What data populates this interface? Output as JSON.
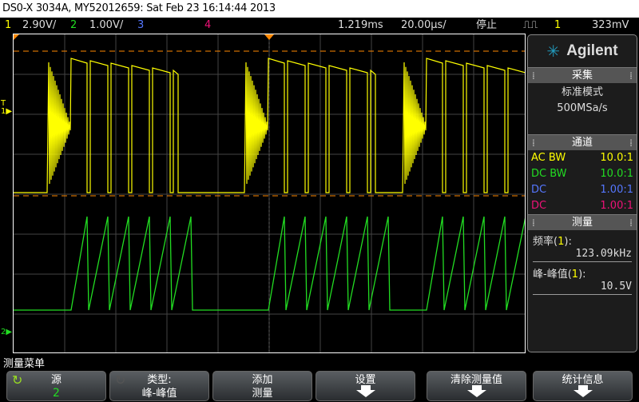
{
  "title": "DS0-X 3034A, MY52012659: Sat Feb 23 16:14:44 2013",
  "status": {
    "ch1_num": "1",
    "ch1_scale": "2.90V/",
    "ch2_num": "2",
    "ch2_scale": "1.00V/",
    "ch3_num": "3",
    "ch4_num": "4",
    "delay": "1.219ms",
    "timebase": "20.00µs/",
    "run_state": "停止",
    "trig_source": "1",
    "trig_level": "323mV"
  },
  "colors": {
    "ch1": "#ffff00",
    "ch2": "#22dd22",
    "ch3": "#5577ff",
    "ch4": "#ee1177",
    "marker": "#ff8800"
  },
  "side": {
    "brand": "Agilent",
    "acq_header": "采集",
    "acq_mode": "标准模式",
    "sample_rate": "500MSa/s",
    "ch_header": "通道",
    "channels": [
      {
        "coupling": "AC BW",
        "probe": "10.0:1"
      },
      {
        "coupling": "DC BW",
        "probe": "10.0:1"
      },
      {
        "coupling": "DC",
        "probe": "1.00:1"
      },
      {
        "coupling": "DC",
        "probe": "1.00:1"
      }
    ],
    "meas_header": "测量",
    "measurements": [
      {
        "name": "频率",
        "src": "1",
        "value": "123.09kHz"
      },
      {
        "name": "峰-峰值",
        "src": "1",
        "value": "10.5V"
      }
    ]
  },
  "menu": {
    "title": "测量菜单",
    "keys": [
      {
        "l1": "源",
        "l2": "2"
      },
      {
        "l1": "类型:",
        "l2": "峰-峰值"
      },
      {
        "l1": "添加",
        "l2": "测量"
      },
      {
        "l1": "设置"
      },
      {
        "l1": "清除测量值"
      },
      {
        "l1": "统计信息"
      }
    ]
  }
}
